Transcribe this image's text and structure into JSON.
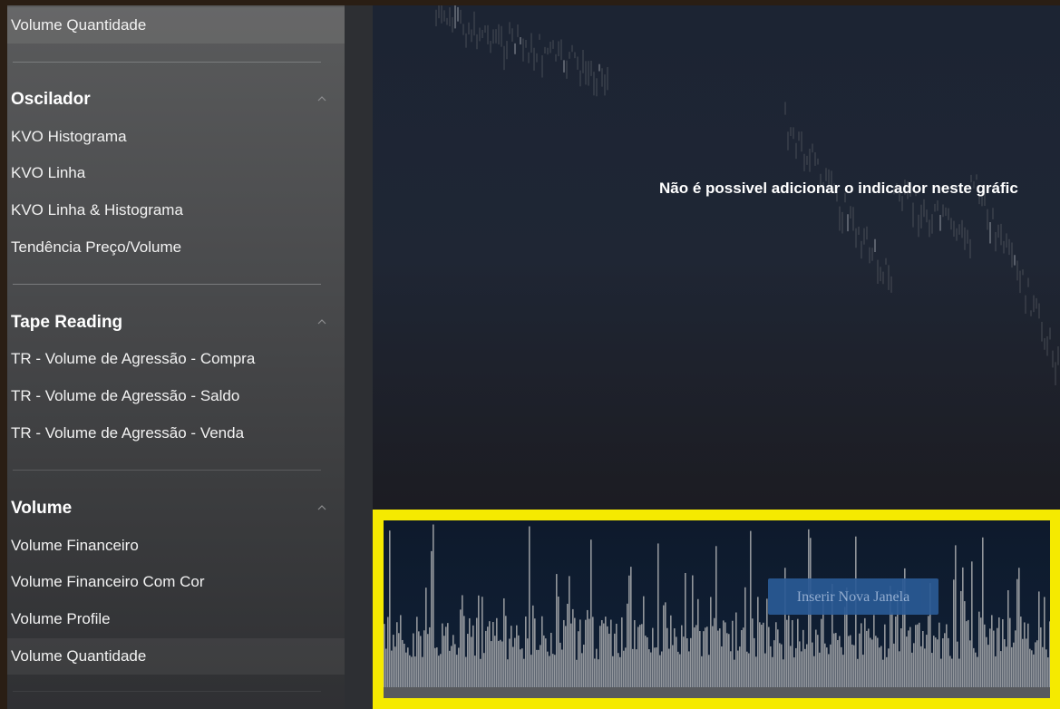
{
  "sidebar": {
    "top_item": "Volume Quantidade",
    "groups": [
      {
        "title": "Oscilador",
        "items": [
          "KVO Histograma",
          "KVO Linha",
          "KVO Linha & Histograma",
          "Tendência Preço/Volume"
        ]
      },
      {
        "title": "Tape Reading",
        "items": [
          "TR - Volume de Agressão - Compra",
          "TR - Volume de Agressão - Saldo",
          "TR - Volume de Agressão - Venda"
        ]
      },
      {
        "title": "Volume",
        "items": [
          "Volume Financeiro",
          "Volume Financeiro Com Cor",
          "Volume Profile",
          "Volume Quantidade"
        ]
      }
    ],
    "chevron_icon": "chevron-up-icon"
  },
  "chart": {
    "message": "Não é possivel adicionar o indicador neste gráfic"
  },
  "volume_panel": {
    "insert_button": "Inserir Nova Janela",
    "highlight_color": "#f5ea00",
    "bar_color": "#a9abae"
  }
}
